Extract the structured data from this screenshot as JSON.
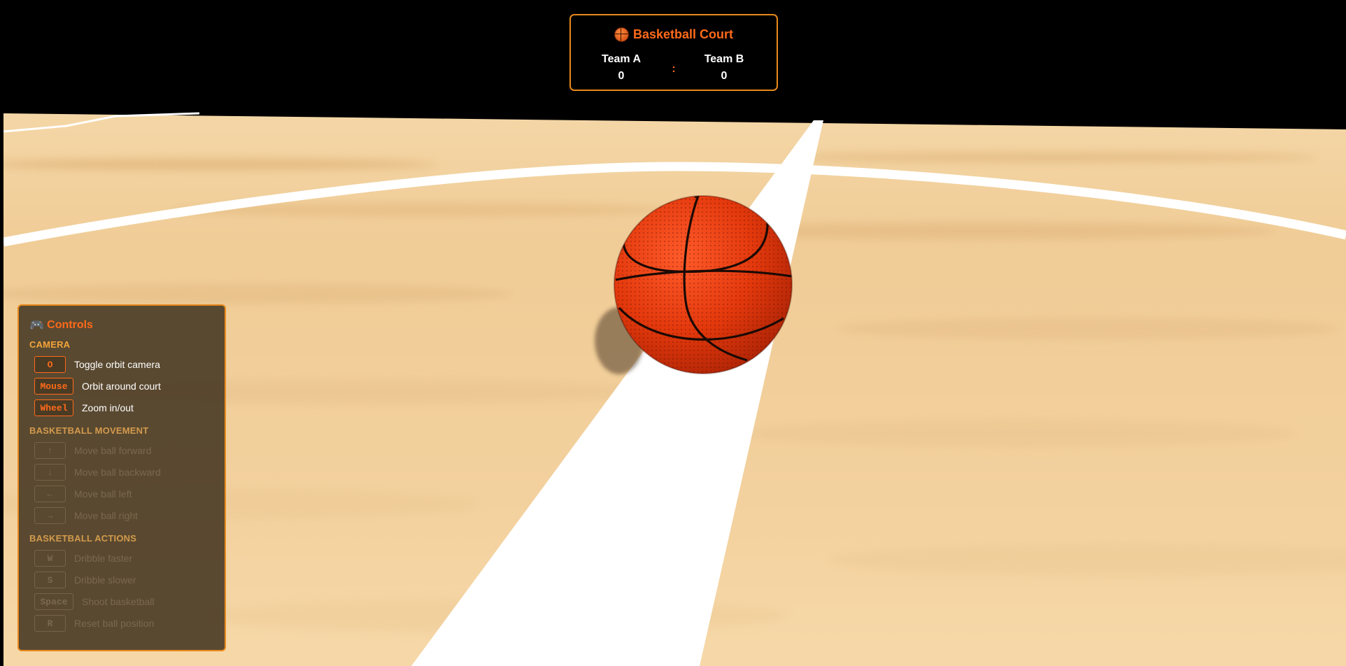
{
  "scoreboard": {
    "title": "Basketball Court",
    "title_icon": "basketball-icon",
    "separator": ":",
    "team_a": {
      "name": "Team A",
      "score": "0"
    },
    "team_b": {
      "name": "Team B",
      "score": "0"
    }
  },
  "controls": {
    "title": "Controls",
    "title_icon": "gamepad-icon",
    "camera": {
      "heading": "CAMERA",
      "items": [
        {
          "key": "O",
          "label": "Toggle orbit camera"
        },
        {
          "key": "Mouse",
          "label": "Orbit around court"
        },
        {
          "key": "Wheel",
          "label": "Zoom in/out"
        }
      ]
    },
    "movement": {
      "heading": "BASKETBALL MOVEMENT",
      "items": [
        {
          "key": "↑",
          "label": "Move ball forward"
        },
        {
          "key": "↓",
          "label": "Move ball backward"
        },
        {
          "key": "←",
          "label": "Move ball left"
        },
        {
          "key": "→",
          "label": "Move ball right"
        }
      ]
    },
    "actions": {
      "heading": "BASKETBALL ACTIONS",
      "items": [
        {
          "key": "W",
          "label": "Dribble faster"
        },
        {
          "key": "S",
          "label": "Dribble slower"
        },
        {
          "key": "Space",
          "label": "Shoot basketball"
        },
        {
          "key": "R",
          "label": "Reset ball position"
        }
      ]
    }
  },
  "colors": {
    "accent": "#ff6a1a",
    "border": "#e8891c",
    "court_wood": "#f2cf9a",
    "court_line": "#ffffff",
    "ball": "#e0400f"
  }
}
